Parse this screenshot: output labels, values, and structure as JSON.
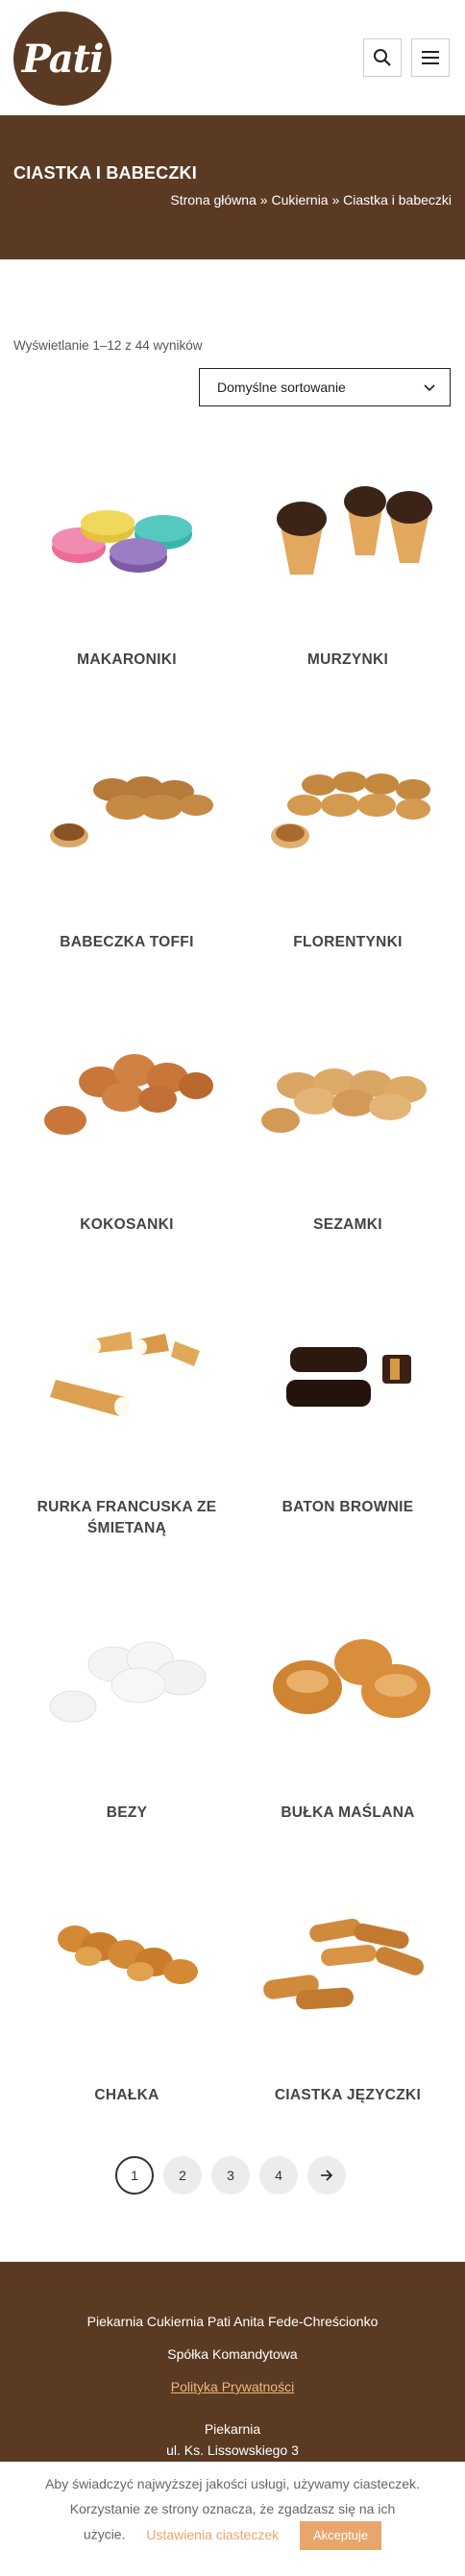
{
  "header": {
    "logo_text": "Pati",
    "search_icon": "search-icon",
    "menu_icon": "hamburger-menu-icon"
  },
  "titlebar": {
    "title": "CIASTKA I BABECZKI",
    "breadcrumb": [
      "Strona główna",
      "Cukiernia",
      "Ciastka i babeczki"
    ],
    "separator": "»"
  },
  "listing": {
    "result_count": "Wyświetlanie 1–12 z 44 wyników",
    "sort_selected": "Domyślne sortowanie"
  },
  "products": [
    {
      "name": "MAKARONIKI",
      "image": "macarons"
    },
    {
      "name": "MURZYNKI",
      "image": "chocolate-cones"
    },
    {
      "name": "BABECZKA TOFFI",
      "image": "toffee-tartlets"
    },
    {
      "name": "FLORENTYNKI",
      "image": "florentines"
    },
    {
      "name": "KOKOSANKI",
      "image": "coconut-cookies"
    },
    {
      "name": "SEZAMKI",
      "image": "sesame-cookies"
    },
    {
      "name": "RURKA FRANCUSKA ZE ŚMIETANĄ",
      "image": "cream-horns"
    },
    {
      "name": "BATON BROWNIE",
      "image": "brownie-bars"
    },
    {
      "name": "BEZY",
      "image": "meringues"
    },
    {
      "name": "BUŁKA MAŚLANA",
      "image": "butter-buns"
    },
    {
      "name": "CHAŁKA",
      "image": "challah"
    },
    {
      "name": "CIASTKA JĘZYCZKI",
      "image": "tongue-cookies"
    }
  ],
  "pagination": {
    "pages": [
      "1",
      "2",
      "3",
      "4"
    ],
    "current": "1",
    "next_icon": "arrow-right-icon"
  },
  "footer": {
    "company_line1": "Piekarnia Cukiernia Pati Anita Fede-Chreścionko",
    "company_line2": "Spółka Komandytowa",
    "privacy_link": "Polityka Prywatności",
    "section_title": "Piekarnia",
    "address": "ul. Ks. Lissowskiego 3"
  },
  "cookie_bar": {
    "line1": "Aby świadczyć najwyższej jakości usługi, używamy ciasteczek.",
    "line2": "Korzystanie ze strony oznacza, że zgadzasz się na ich",
    "line3_prefix": "użycie.",
    "settings_link": "Ustawienia ciasteczek",
    "accept_label": "Akceptuje"
  },
  "colors": {
    "brand_brown": "#5b3a23",
    "accent_orange": "#e9a66c"
  }
}
